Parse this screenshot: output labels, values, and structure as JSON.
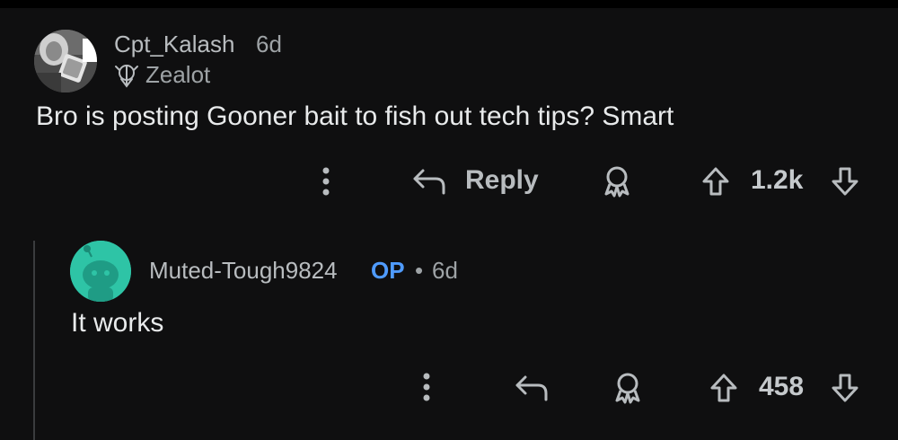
{
  "comment1": {
    "username": "Cpt_Kalash",
    "age": "6d",
    "flair": "Zealot",
    "body": "Bro is posting Gooner bait to fish out tech tips? Smart",
    "reply_label": "Reply",
    "score": "1.2k",
    "icons": [
      "more-options-icon",
      "reply-arrow-icon",
      "award-icon",
      "upvote-arrow-icon",
      "downvote-arrow-icon",
      "flair-badge-icon"
    ]
  },
  "comment2": {
    "username": "Muted-Tough9824",
    "op_badge": "OP",
    "separator": "•",
    "age": "6d",
    "body": "It works",
    "score": "458",
    "icons": [
      "more-options-icon",
      "reply-arrow-icon",
      "award-icon",
      "upvote-arrow-icon",
      "downvote-arrow-icon",
      "snoo-avatar-icon"
    ]
  },
  "colors": {
    "background": "#0f0f10",
    "op_badge": "#4f9bff",
    "snoo_avatar": "#2ec4a6"
  }
}
